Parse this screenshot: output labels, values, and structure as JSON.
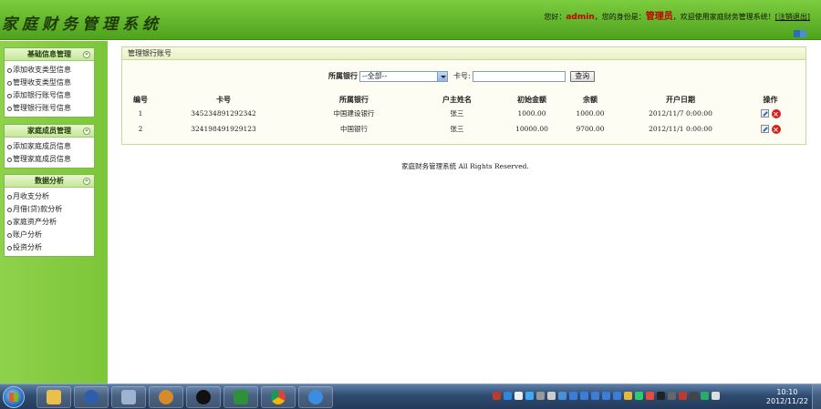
{
  "header": {
    "logo": "家庭财务管理系统",
    "welcome_prefix": "您好：",
    "username": "admin",
    "role_prefix": "，您的身份是：",
    "role": "管理员",
    "welcome_suffix": "，欢迎使用家庭财务管理系统！",
    "logout_label": "[注销退出]"
  },
  "sidebar": {
    "groups": [
      {
        "title": "基础信息管理",
        "items": [
          "添加收支类型信息",
          "管理收支类型信息",
          "添加银行账号信息",
          "管理银行账号信息"
        ]
      },
      {
        "title": "家庭成员管理",
        "items": [
          "添加家庭成员信息",
          "管理家庭成员信息"
        ]
      },
      {
        "title": "数据分析",
        "items": [
          "月收支分析",
          "月借(贷)款分析",
          "家庭资产分析",
          "账户分析",
          "投资分析"
        ]
      }
    ],
    "toggle_glyph": "«"
  },
  "main": {
    "panel_title": "管理银行账号",
    "search": {
      "bank_label": "所属银行",
      "bank_selected": "--全部--",
      "card_label": "卡号:",
      "card_value": "",
      "query_label": "查询"
    },
    "table": {
      "headers": [
        "编号",
        "卡号",
        "所属银行",
        "户主姓名",
        "初始金额",
        "余额",
        "开户日期",
        "操作"
      ],
      "rows": [
        [
          "1",
          "345234891292342",
          "中国建设银行",
          "张三",
          "1000.00",
          "1000.00",
          "2012/11/7 0:00:00"
        ],
        [
          "2",
          "324198491929123",
          "中国银行",
          "张三",
          "10000.00",
          "9700.00",
          "2012/11/1 0:00:00"
        ]
      ]
    },
    "footer": "家庭财务管理系统 All Rights Reserved."
  },
  "taskbar": {
    "time": "10:10",
    "date": "2012/11/22",
    "colors": {
      "accent": "#4ea21c",
      "brand_red": "#c00000"
    }
  }
}
